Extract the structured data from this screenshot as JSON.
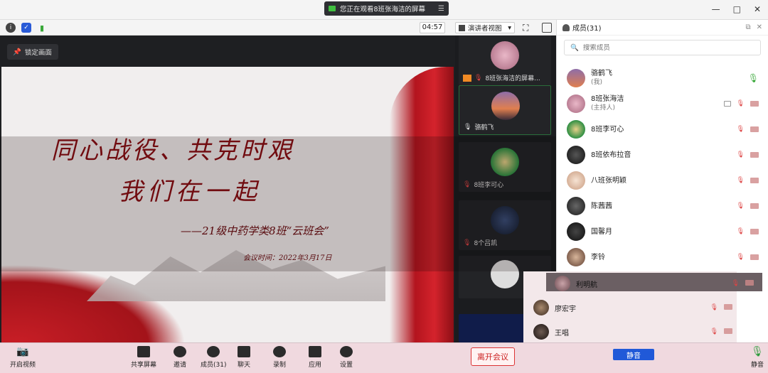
{
  "window": {
    "share_banner": "您正在观看8班张海洁的屏幕",
    "controls": [
      "—",
      "□",
      "✕"
    ]
  },
  "toolbar": {
    "timer": "04:57",
    "view_mode": "演讲者视图"
  },
  "stage": {
    "lock_label": "锁定画面",
    "slide": {
      "line1": "同心战役、共克时艰",
      "line2": "我们在一起",
      "line3": "——21级中药学类8班“云班会”",
      "line4": "会议时间：2022年3月17日"
    }
  },
  "strip": {
    "tiles": [
      {
        "name": "8班张海洁的屏幕..."
      },
      {
        "name": "骆鹤飞"
      },
      {
        "name": "8班李可心"
      },
      {
        "name": "8个吕凯"
      }
    ]
  },
  "panel": {
    "title": "成员(31)",
    "search_placeholder": "搜索成员",
    "members": [
      {
        "name": "骆鹤飞",
        "role": "(我)"
      },
      {
        "name": "8班张海洁",
        "role": "(主持人)"
      },
      {
        "name": "8班李可心",
        "role": ""
      },
      {
        "name": "8班依布拉音",
        "role": ""
      },
      {
        "name": "八班张明颖",
        "role": ""
      },
      {
        "name": "陈茜茜",
        "role": ""
      },
      {
        "name": "国馨月",
        "role": ""
      },
      {
        "name": "李铃",
        "role": ""
      }
    ],
    "lower": [
      {
        "name": "利明航"
      },
      {
        "name": "廖宏宇"
      },
      {
        "name": "王唱"
      }
    ],
    "mute_all": "静音"
  },
  "bottom": {
    "start_video": "开启视频",
    "share_screen": "共享屏幕",
    "invite": "邀请",
    "members": "成员(31)",
    "chat": "聊天",
    "record": "录制",
    "apps": "应用",
    "settings": "设置",
    "leave": "离开会议",
    "mute": "静音"
  },
  "colors": {
    "accent_blue": "#2059d8",
    "leave_red": "#cc2222",
    "slide_red": "#8b0e14"
  }
}
